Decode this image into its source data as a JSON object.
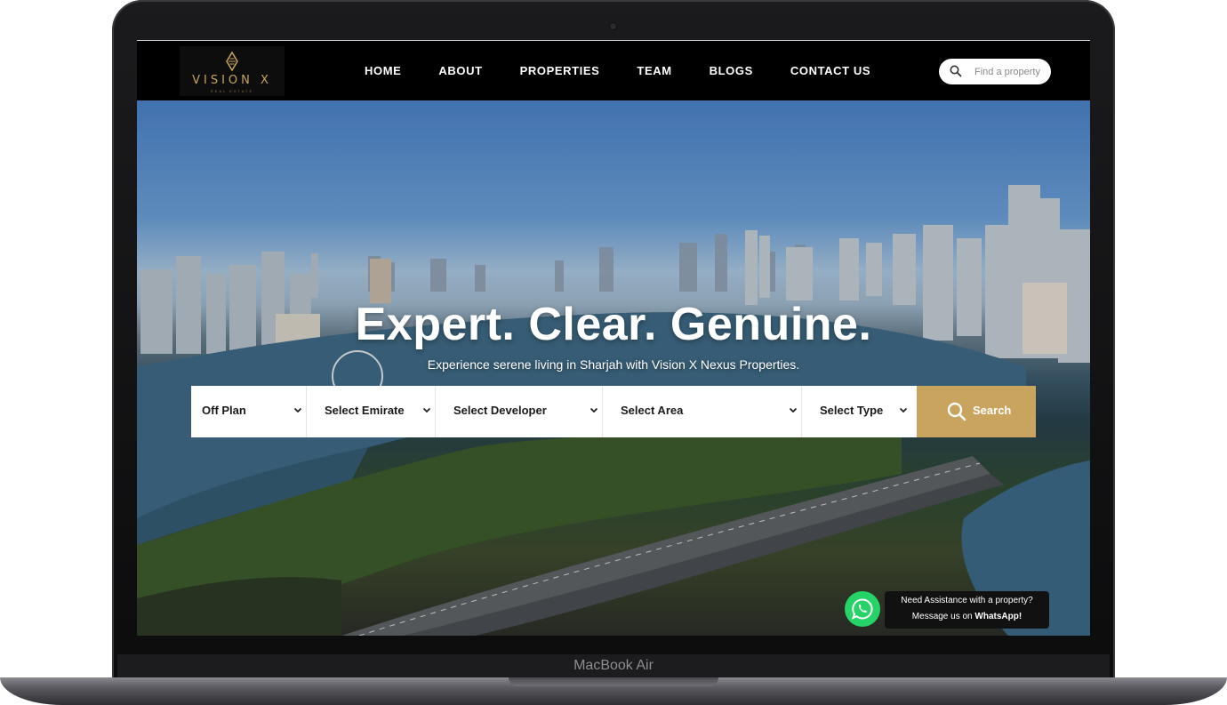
{
  "device": {
    "model_label": "MacBook Air"
  },
  "header": {
    "logo_text": "VISION X",
    "logo_subtext": "REAL ESTATE",
    "nav": [
      {
        "label": "HOME"
      },
      {
        "label": "ABOUT"
      },
      {
        "label": "PROPERTIES"
      },
      {
        "label": "TEAM"
      },
      {
        "label": "BLOGS"
      },
      {
        "label": "CONTACT US"
      }
    ],
    "search": {
      "placeholder": "Find a property",
      "value": ""
    }
  },
  "hero": {
    "title": "Expert. Clear. Genuine.",
    "subtitle": "Experience serene living in Sharjah with Vision X Nexus Properties."
  },
  "search_bar": {
    "filters": [
      {
        "label": "Off Plan"
      },
      {
        "label": "Select Emirate"
      },
      {
        "label": "Select Developer"
      },
      {
        "label": "Select Area"
      },
      {
        "label": "Select Type"
      }
    ],
    "button_label": "Search"
  },
  "whatsapp": {
    "line1": "Need Assistance with a property?",
    "line2_prefix": "Message us on ",
    "line2_bold": "WhatsApp!"
  },
  "colors": {
    "accent_gold": "#c9a45f",
    "header_bg": "#000000",
    "whatsapp_green": "#25d366"
  },
  "icons": {
    "header_search": "search-icon",
    "filter_dropdown": "chevron-down-icon",
    "search_button": "magnifier-icon",
    "whatsapp": "whatsapp-icon"
  }
}
